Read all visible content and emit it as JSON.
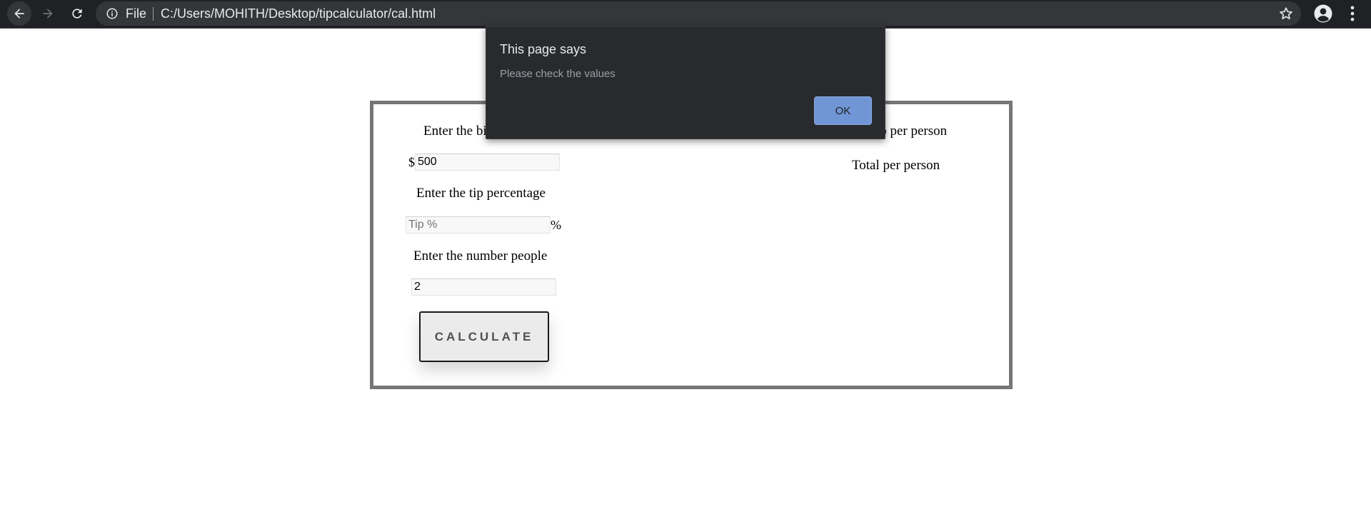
{
  "browser": {
    "scheme_label": "File",
    "url": "C:/Users/MOHITH/Desktop/tipcalculator/cal.html"
  },
  "calculator": {
    "bill_label": "Enter the bill amount",
    "bill_currency": "$",
    "bill_value": "500",
    "tip_label": "Enter the tip percentage",
    "tip_placeholder": "Tip %",
    "tip_value": "",
    "tip_unit": "%",
    "people_label": "Enter the number people",
    "people_value": "2",
    "calculate_label": "CALCULATE",
    "tip_per_person_label": "Tip per person",
    "total_per_person_label": "Total per person"
  },
  "alert": {
    "title": "This page says",
    "message": "Please check the values",
    "ok_label": "OK",
    "ok_color": "#7096d6"
  }
}
